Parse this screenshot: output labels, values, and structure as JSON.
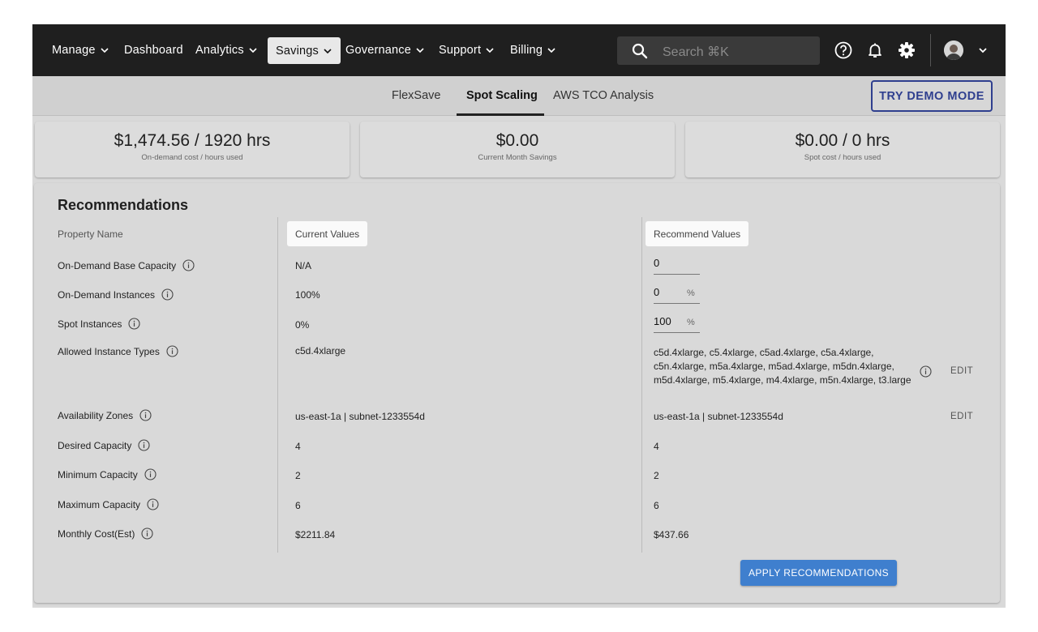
{
  "nav": {
    "items": [
      {
        "label": "Manage",
        "has_menu": true
      },
      {
        "label": "Dashboard",
        "has_menu": false
      },
      {
        "label": "Analytics",
        "has_menu": true
      },
      {
        "label": "Savings",
        "has_menu": true,
        "active": true
      },
      {
        "label": "Governance",
        "has_menu": true
      },
      {
        "label": "Support",
        "has_menu": true
      },
      {
        "label": "Billing",
        "has_menu": true
      }
    ],
    "search_placeholder": "Search ⌘K",
    "icons": [
      "help-icon",
      "bell-icon",
      "gear-icon",
      "avatar",
      "chevron-down-icon"
    ]
  },
  "subnav": {
    "tabs": [
      {
        "label": "FlexSave"
      },
      {
        "label": "Spot Scaling",
        "active": true
      },
      {
        "label": "AWS TCO Analysis"
      }
    ],
    "demo_button": "TRY DEMO MODE"
  },
  "summary": [
    {
      "value": "$1,474.56 / 1920 hrs",
      "caption": "On-demand cost / hours used"
    },
    {
      "value": "$0.00",
      "caption": "Current Month Savings"
    },
    {
      "value": "$0.00 / 0 hrs",
      "caption": "Spot cost / hours used"
    }
  ],
  "recommendations": {
    "title": "Recommendations",
    "headers": {
      "property": "Property Name",
      "current": "Current Values",
      "recommended": "Recommend Values"
    },
    "rows": [
      {
        "label": "On-Demand Base Capacity",
        "current": "N/A",
        "recommended": "0"
      },
      {
        "label": "On-Demand Instances",
        "current": "100%",
        "recommended": "0",
        "unit": "%"
      },
      {
        "label": "Spot Instances",
        "current": "0%",
        "recommended": "100",
        "unit": "%"
      },
      {
        "label": "Allowed Instance Types",
        "current": "c5d.4xlarge",
        "recommended": "c5d.4xlarge, c5.4xlarge, c5ad.4xlarge, c5a.4xlarge, c5n.4xlarge, m5a.4xlarge, m5ad.4xlarge, m5dn.4xlarge, m5d.4xlarge, m5.4xlarge, m4.4xlarge, m5n.4xlarge, t3.large",
        "edit": "EDIT"
      },
      {
        "label": "Availability Zones",
        "current": "us-east-1a | subnet-1233554d",
        "recommended": "us-east-1a | subnet-1233554d",
        "edit": "EDIT"
      },
      {
        "label": "Desired Capacity",
        "current": "4",
        "recommended": "4"
      },
      {
        "label": "Minimum Capacity",
        "current": "2",
        "recommended": "2"
      },
      {
        "label": "Maximum Capacity",
        "current": "6",
        "recommended": "6"
      },
      {
        "label": "Monthly Cost(Est)",
        "current": "$2211.84",
        "recommended": "$437.66"
      }
    ],
    "apply_button": "APPLY RECOMMENDATIONS"
  },
  "colors": {
    "topbar": "#1f1f1f",
    "accent": "#2f3f8f",
    "apply": "#3f7fce"
  }
}
